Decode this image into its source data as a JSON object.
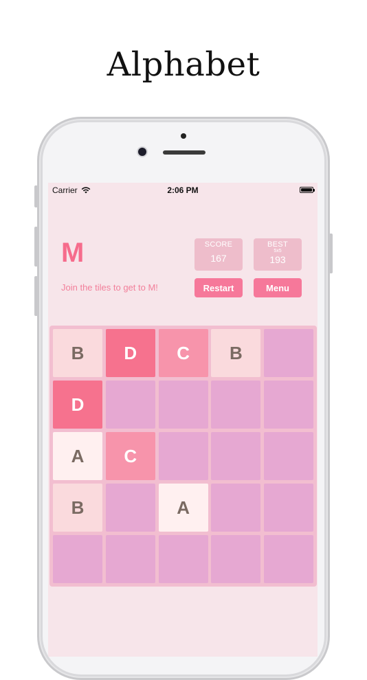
{
  "headline": "Alphabet",
  "status_bar": {
    "carrier": "Carrier",
    "time": "2:06 PM"
  },
  "game": {
    "target_letter": "M",
    "instructions": "Join the tiles to get to M!",
    "score": {
      "label": "SCORE",
      "value": "167"
    },
    "best": {
      "label": "BEST",
      "mode": "5x5",
      "value": "193"
    },
    "restart_label": "Restart",
    "menu_label": "Menu"
  },
  "board": {
    "rows": 5,
    "cols": 5,
    "cells": [
      [
        "B",
        "D",
        "C",
        "B",
        ""
      ],
      [
        "D",
        "",
        "",
        "",
        ""
      ],
      [
        "A",
        "C",
        "",
        "",
        ""
      ],
      [
        "B",
        "",
        "A",
        "",
        ""
      ],
      [
        "",
        "",
        "",
        "",
        ""
      ]
    ]
  },
  "colors": {
    "screen_bg": "#f7e5ea",
    "board_bg": "#f2bed0",
    "empty_cell": "#e6a8d2",
    "tile_A": "#fff0f0",
    "tile_B": "#fadadd",
    "tile_C": "#f794ab",
    "tile_D": "#f6728e",
    "accent": "#f6789a"
  }
}
